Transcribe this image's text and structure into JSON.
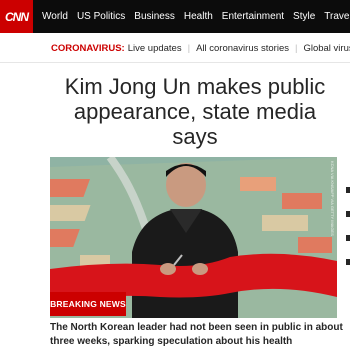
{
  "brand": {
    "logo_text": "CNN",
    "accent": "#cc0000"
  },
  "nav": {
    "items": [
      {
        "label": "World"
      },
      {
        "label": "US Politics"
      },
      {
        "label": "Business"
      },
      {
        "label": "Health"
      },
      {
        "label": "Entertainment"
      },
      {
        "label": "Style"
      },
      {
        "label": "Travel"
      }
    ]
  },
  "ticker": {
    "label": "CORONAVIRUS:",
    "links": [
      "Live updates",
      "All coronavirus stories",
      "Global virus m"
    ]
  },
  "story": {
    "headline": "Kim Jong Un makes public appearance, state media says",
    "badge": "BREAKING NEWS",
    "summary": "The North Korean leader had not been seen in public in about three weeks, sparking speculation about his health",
    "image_credit": "KCNA VIA KNS/AFP VIA GETTY IMAGES"
  }
}
